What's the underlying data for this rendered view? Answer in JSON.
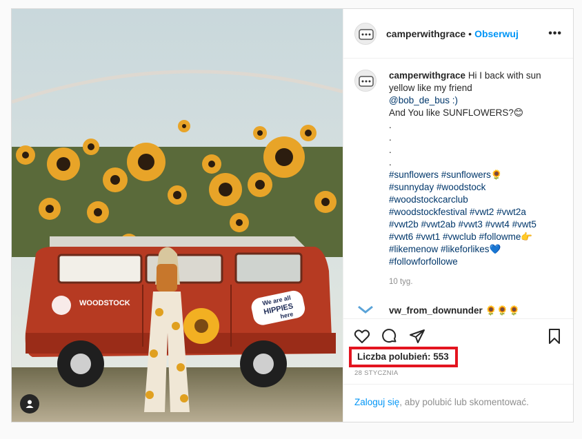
{
  "post": {
    "username": "camperwithgrace",
    "separator": "•",
    "follow_label": "Obserwuj",
    "more_label": "•••",
    "caption": {
      "username": "camperwithgrace",
      "line1": "Hi I back with sun yellow like my friend",
      "line2": "@bob_de_bus :)",
      "line3": "And You like SUNFLOWERS?😊",
      "dots": [
        ".",
        ".",
        ".",
        "."
      ],
      "hashtags": [
        "#sunflowers #sunflowers🌻",
        "#sunnyday #woodstock",
        "#woodstockcarclub",
        "#woodstockfestival #vwt2 #vwt2a",
        "#vwt2b #vwt2ab #vwt3 #vwt4 #vwt5",
        "#vwt6 #vwt1 #vwclub #followme👉",
        "#likemenow #likeforlikes💙",
        "#followforfollowe"
      ],
      "time": "10 tyg."
    },
    "next_comment_user": "vw_from_downunder 🌻🌻🌻",
    "likes_text": "Liczba polubień: 553",
    "date": "28 STYCZNIA",
    "login_link": "Zaloguj się",
    "login_rest": ", aby polubić lub skomentować."
  },
  "photo": {
    "van_badge": "WOODSTOCK",
    "sticker_line1": "We are all",
    "sticker_line2": "HIPPIES",
    "sticker_line3": "here"
  },
  "icons": [
    "heart-icon",
    "comment-icon",
    "share-icon",
    "bookmark-icon",
    "user-tag-icon",
    "more-icon"
  ]
}
